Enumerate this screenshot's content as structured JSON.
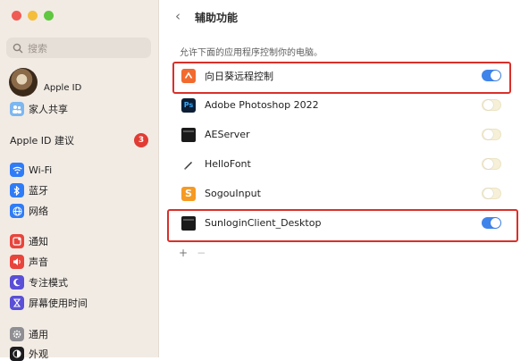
{
  "sidebar": {
    "search_placeholder": "搜索",
    "apple_id_label": "Apple ID",
    "family_label": "家人共享",
    "suggestions_label": "Apple ID 建议",
    "suggestions_badge": "3",
    "items": [
      {
        "label": "Wi-Fi",
        "icon": "wifi-icon",
        "color": "#2f7cf6"
      },
      {
        "label": "蓝牙",
        "icon": "bluetooth-icon",
        "color": "#2f7cf6"
      },
      {
        "label": "网络",
        "icon": "globe-icon",
        "color": "#2f7cf6"
      },
      {
        "label": "通知",
        "icon": "bell-icon",
        "color": "#e8453c"
      },
      {
        "label": "声音",
        "icon": "speaker-icon",
        "color": "#e8453c"
      },
      {
        "label": "专注模式",
        "icon": "moon-icon",
        "color": "#5a4fd6"
      },
      {
        "label": "屏幕使用时间",
        "icon": "hourglass-icon",
        "color": "#5a4fd6"
      },
      {
        "label": "通用",
        "icon": "gear-icon",
        "color": "#8e8e93"
      },
      {
        "label": "外观",
        "icon": "appearance-icon",
        "color": "#1c1c1e"
      }
    ]
  },
  "main": {
    "title": "辅助功能",
    "description": "允许下面的应用程序控制你的电脑。",
    "apps": [
      {
        "name": "向日葵远程控制",
        "icon": "sunflower-remote-icon",
        "enabled": true,
        "highlighted": true
      },
      {
        "name": "Adobe Photoshop 2022",
        "icon": "photoshop-icon",
        "enabled": false,
        "highlighted": false
      },
      {
        "name": "AEServer",
        "icon": "terminal-icon",
        "enabled": false,
        "highlighted": false
      },
      {
        "name": "HelloFont",
        "icon": "pen-icon",
        "enabled": false,
        "highlighted": false
      },
      {
        "name": "SogouInput",
        "icon": "sogou-icon",
        "enabled": false,
        "highlighted": false
      },
      {
        "name": "SunloginClient_Desktop",
        "icon": "terminal-icon",
        "enabled": true,
        "highlighted": true
      }
    ],
    "add_label": "+",
    "remove_label": "−"
  },
  "colors": {
    "accent": "#3f84ea",
    "highlight": "#d9302a",
    "sidebar_bg": "#f2ebe4"
  }
}
